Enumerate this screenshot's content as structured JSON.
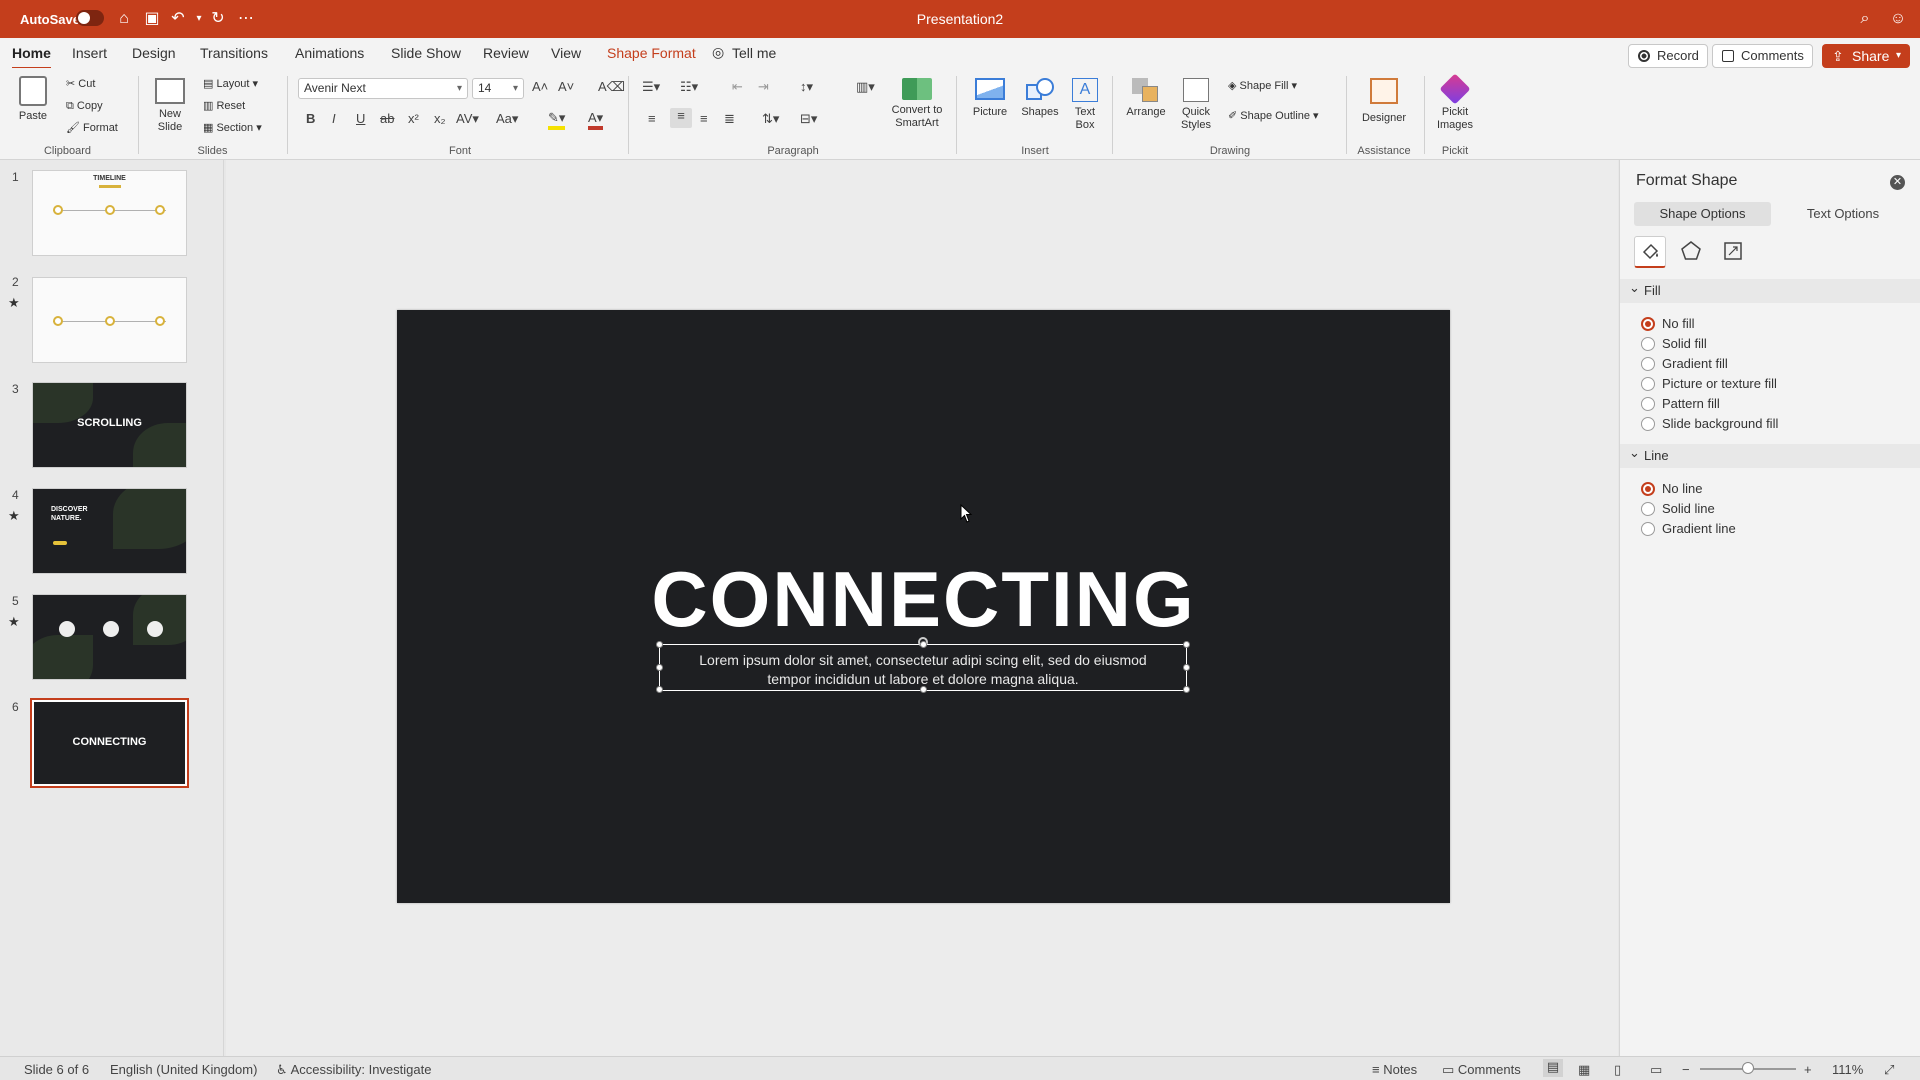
{
  "titlebar": {
    "autosave": "AutoSave",
    "title": "Presentation2"
  },
  "tabs": [
    "Home",
    "Insert",
    "Design",
    "Transitions",
    "Animations",
    "Slide Show",
    "Review",
    "View",
    "Shape Format",
    "Tell me"
  ],
  "actions": {
    "record": "Record",
    "comments": "Comments",
    "share": "Share"
  },
  "ribbon": {
    "paste": "Paste",
    "cut": "Cut",
    "copy": "Copy",
    "format": "Format",
    "clipboard": "Clipboard",
    "new_slide": "New Slide",
    "layout": "Layout",
    "reset": "Reset",
    "section": "Section",
    "slides": "Slides",
    "font_name": "Avenir Next",
    "font_size": "14",
    "font": "Font",
    "paragraph": "Paragraph",
    "convert_smartart": "Convert to SmartArt",
    "picture": "Picture",
    "shapes": "Shapes",
    "text_box": "Text Box",
    "insert": "Insert",
    "arrange": "Arrange",
    "quick_styles": "Quick Styles",
    "shape_fill": "Shape Fill",
    "shape_outline": "Shape Outline",
    "drawing": "Drawing",
    "designer": "Designer",
    "assistance": "Assistance",
    "pickit_images": "Pickit Images",
    "pickit": "Pickit"
  },
  "slides_panel": {
    "numbers": [
      "1",
      "2",
      "3",
      "4",
      "5",
      "6"
    ],
    "thumb1_title": "TIMELINE",
    "thumb3_title": "SCROLLING",
    "thumb4_title": "DISCOVER NATURE.",
    "thumb6_title": "CONNECTING"
  },
  "slide": {
    "title": "CONNECTING",
    "body_line1": "Lorem ipsum dolor sit amet, consectetur adipi scing elit, sed do eiusmod",
    "body_line2": "tempor incididun ut labore et dolore magna aliqua."
  },
  "format_pane": {
    "title": "Format Shape",
    "tab_shape": "Shape Options",
    "tab_text": "Text Options",
    "fill_header": "Fill",
    "fill_options": [
      "No fill",
      "Solid fill",
      "Gradient fill",
      "Picture or texture fill",
      "Pattern fill",
      "Slide background fill"
    ],
    "fill_selected": "No fill",
    "line_header": "Line",
    "line_options": [
      "No line",
      "Solid line",
      "Gradient line"
    ],
    "line_selected": "No line"
  },
  "statusbar": {
    "slide": "Slide 6 of 6",
    "language": "English (United Kingdom)",
    "accessibility": "Accessibility: Investigate",
    "notes": "Notes",
    "comments": "Comments",
    "zoom": "111%"
  },
  "colors": {
    "accent": "#c43e1c",
    "slide_bg": "#1e1f22",
    "timeline_gold": "#d8b23c"
  }
}
